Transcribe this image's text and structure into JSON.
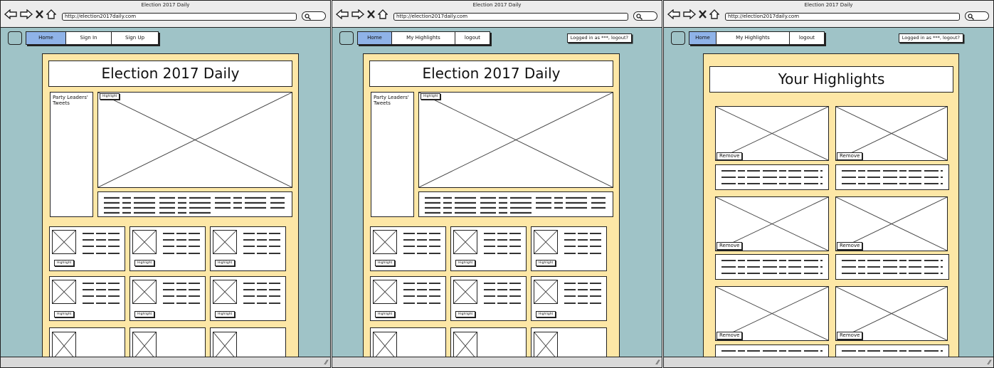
{
  "browser": {
    "window_title": "Election 2017 Daily",
    "url": "http://election2017daily.com"
  },
  "screen1": {
    "tabs": [
      "Home",
      "Sign In",
      "Sign Up"
    ],
    "title": "Election 2017 Daily",
    "tweets_label": "Party Leaders' Tweets",
    "highlight_label": "Highlight"
  },
  "screen2": {
    "tabs": [
      "Home",
      "My Highlights",
      "logout"
    ],
    "login_status": "Logged in as ***, logout?",
    "title": "Election 2017 Daily",
    "tweets_label": "Party Leaders' Tweets",
    "highlight_label": "Highlight"
  },
  "screen3": {
    "tabs": [
      "Home",
      "My Highlights",
      "logout"
    ],
    "login_status": "Logged in as ***, logout?",
    "title": "Your Highlights",
    "remove_label": "Remove"
  },
  "icons": [
    "back-arrow-icon",
    "forward-arrow-icon",
    "stop-x-icon",
    "home-icon",
    "search-icon",
    "resize-grip-icon"
  ],
  "colors": {
    "window_bg": "#9fc3c7",
    "paper": "#fde7a6",
    "active_tab": "#8fb3e8"
  }
}
